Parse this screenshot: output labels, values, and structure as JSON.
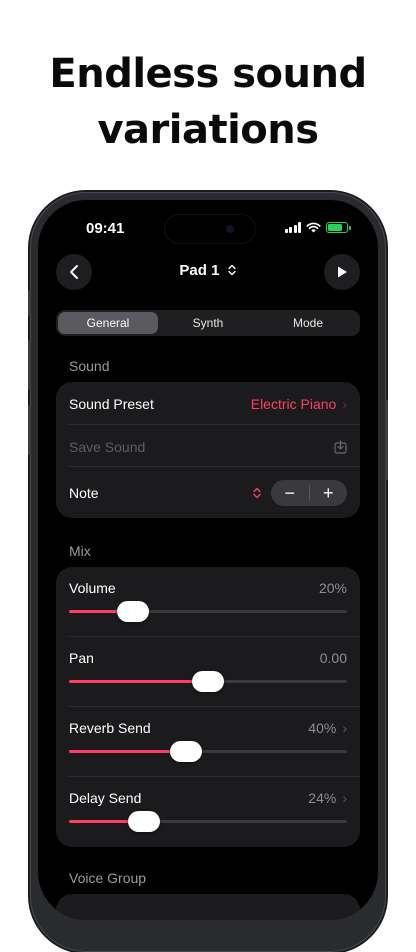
{
  "headline": {
    "line1": "Endless sound",
    "line2": "variations"
  },
  "status_bar": {
    "time": "09:41"
  },
  "nav": {
    "title": "Pad 1",
    "back_icon": "chevron-left-icon",
    "play_icon": "play-icon"
  },
  "tabs": [
    {
      "label": "General",
      "active": true
    },
    {
      "label": "Synth",
      "active": false
    },
    {
      "label": "Mode",
      "active": false
    }
  ],
  "sound_section": {
    "label": "Sound",
    "preset_label": "Sound Preset",
    "preset_value": "Electric Piano",
    "save_label": "Save Sound",
    "note_label": "Note",
    "minus": "−",
    "plus": "+"
  },
  "mix_section": {
    "label": "Mix",
    "sliders": [
      {
        "label": "Volume",
        "value_text": "20%",
        "level": 0.23,
        "chevron": false
      },
      {
        "label": "Pan",
        "value_text": "0.00",
        "level": 0.5,
        "chevron": false
      },
      {
        "label": "Reverb Send",
        "value_text": "40%",
        "level": 0.42,
        "chevron": true
      },
      {
        "label": "Delay Send",
        "value_text": "24%",
        "level": 0.27,
        "chevron": true
      }
    ]
  },
  "voice_group_section": {
    "label": "Voice Group"
  },
  "colors": {
    "accent": "#ff3e63",
    "background": "#000000",
    "card": "#1b1b1d"
  }
}
